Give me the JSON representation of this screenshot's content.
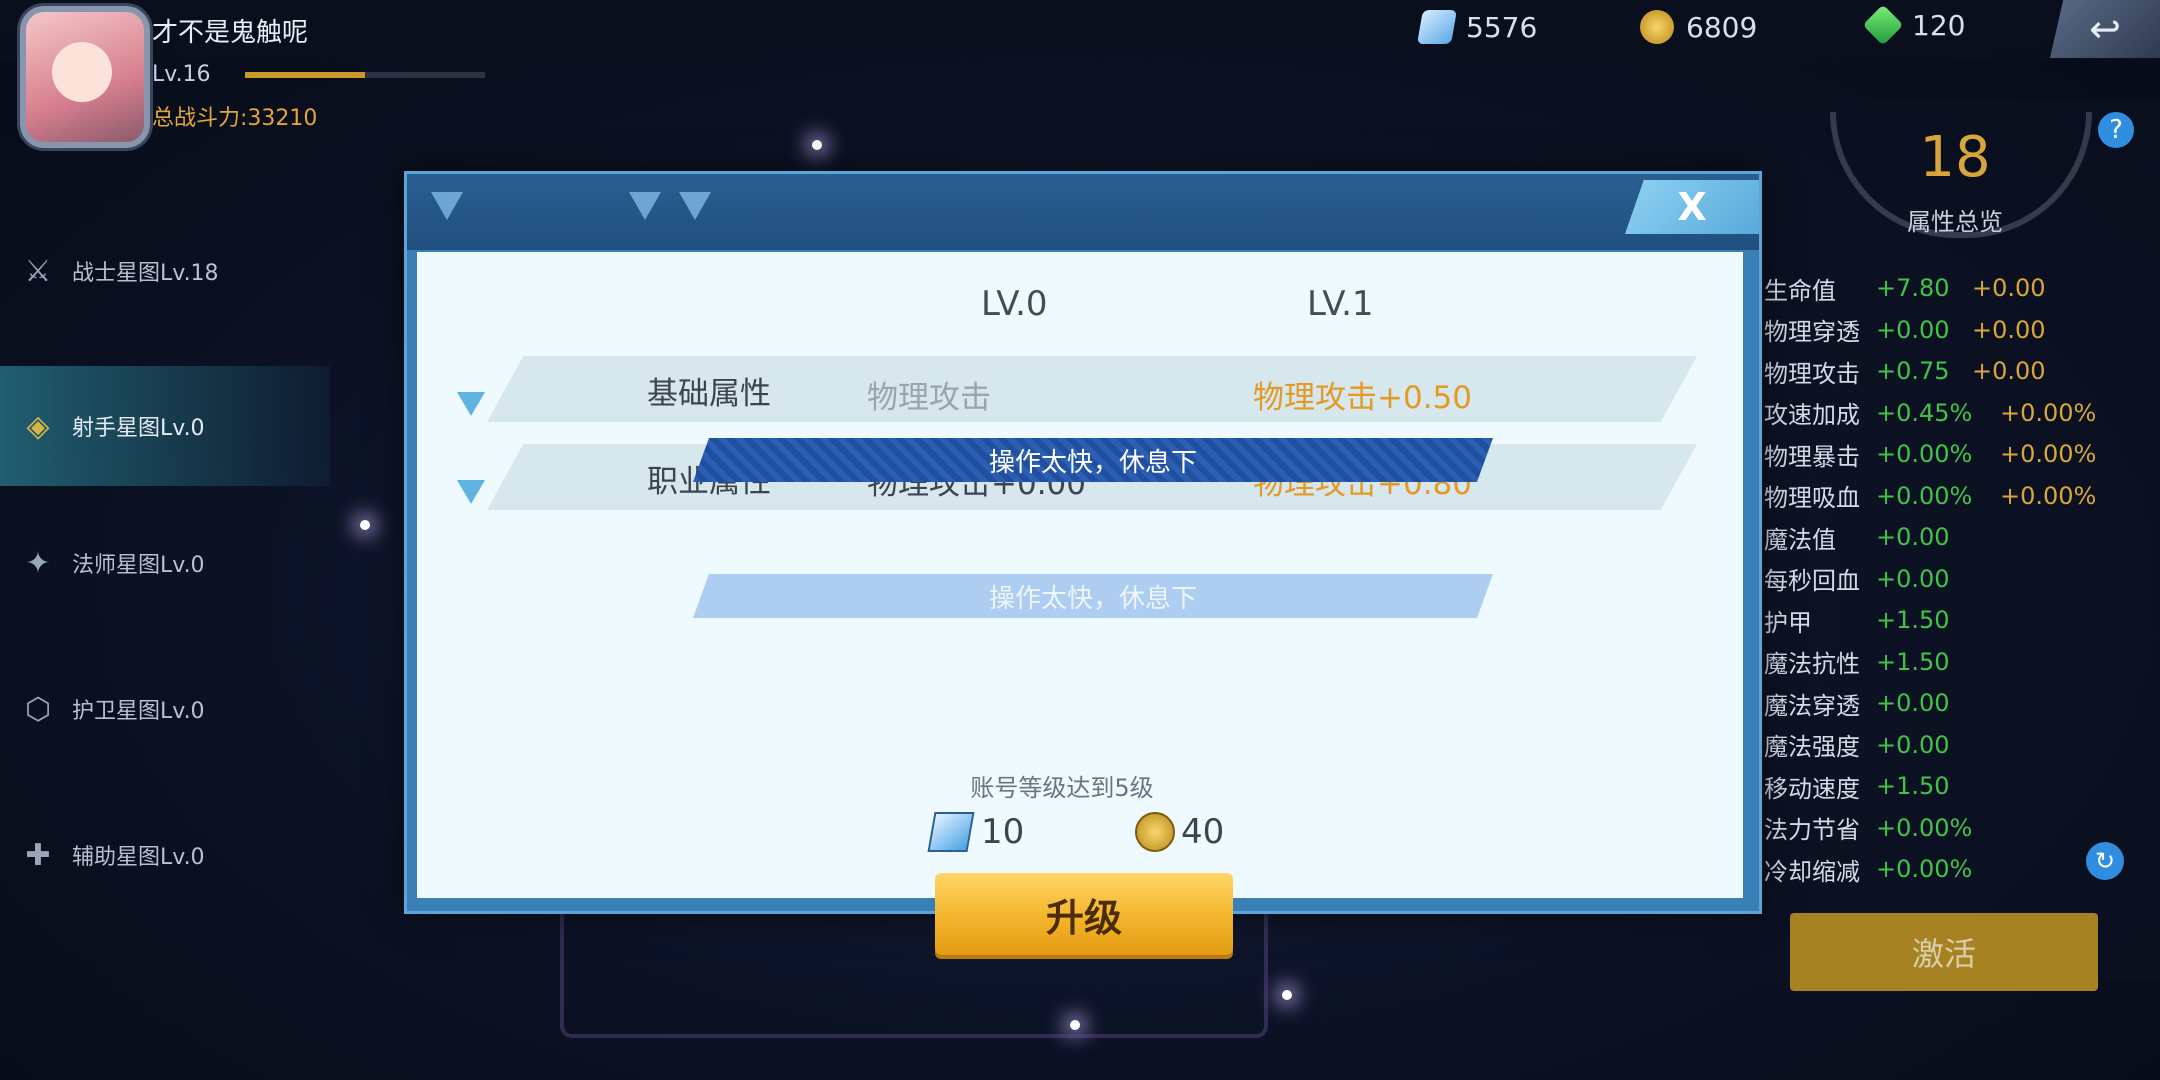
{
  "player": {
    "name": "才不是鬼触呢",
    "level": "Lv.16",
    "xp_progress": 0.5,
    "power": "总战斗力:33210"
  },
  "resources": [
    {
      "icon": "star-crystal-icon",
      "value": "5576"
    },
    {
      "icon": "gold-coin-icon",
      "value": "6809"
    },
    {
      "icon": "green-gem-plus-icon",
      "value": "120"
    }
  ],
  "back_icon": "back-arrow-icon",
  "sidebar": {
    "items": [
      {
        "label": "战士星图Lv.18",
        "icon": "warrior-emblem-icon",
        "active": false
      },
      {
        "label": "射手星图Lv.0",
        "icon": "archer-emblem-icon",
        "active": true
      },
      {
        "label": "法师星图Lv.0",
        "icon": "mage-emblem-icon",
        "active": false
      },
      {
        "label": "护卫星图Lv.0",
        "icon": "guardian-emblem-icon",
        "active": false
      },
      {
        "label": "辅助星图Lv.0",
        "icon": "support-emblem-icon",
        "active": false
      }
    ]
  },
  "right_panel": {
    "level": "18",
    "title": "属性总览",
    "help_icon": "help-icon",
    "stats": [
      {
        "name": "生命值",
        "a": "+7.80",
        "b": "+0.00"
      },
      {
        "name": "物理穿透",
        "a": "+0.00",
        "b": "+0.00"
      },
      {
        "name": "物理攻击",
        "a": "+0.75",
        "b": "+0.00"
      },
      {
        "name": "攻速加成",
        "a": "+0.45%",
        "b": "+0.00%"
      },
      {
        "name": "物理暴击",
        "a": "+0.00%",
        "b": "+0.00%"
      },
      {
        "name": "物理吸血",
        "a": "+0.00%",
        "b": "+0.00%"
      },
      {
        "name": "魔法值",
        "a": "+0.00",
        "b": ""
      },
      {
        "name": "每秒回血",
        "a": "+0.00",
        "b": ""
      },
      {
        "name": "护甲",
        "a": "+1.50",
        "b": ""
      },
      {
        "name": "魔法抗性",
        "a": "+1.50",
        "b": ""
      },
      {
        "name": "魔法穿透",
        "a": "+0.00",
        "b": ""
      },
      {
        "name": "魔法强度",
        "a": "+0.00",
        "b": ""
      },
      {
        "name": "移动速度",
        "a": "+1.50",
        "b": ""
      },
      {
        "name": "法力节省",
        "a": "+0.00%",
        "b": ""
      },
      {
        "name": "冷却缩减",
        "a": "+0.00%",
        "b": ""
      }
    ],
    "activate_label": "激活"
  },
  "dialog": {
    "close_label": "X",
    "current_level": "LV.0",
    "next_level": "LV.1",
    "rows": [
      {
        "label": "基础属性",
        "current": "物理攻击",
        "next": "物理攻击+0.50"
      },
      {
        "label": "职业属性",
        "current": "物理攻击+0.00",
        "next": "物理攻击+0.80"
      }
    ],
    "toast": "操作太快，休息下",
    "requirement": "账号等级达到5级",
    "cost": [
      {
        "icon": "star-crystal-icon",
        "value": "10"
      },
      {
        "icon": "gold-coin-icon",
        "value": "40"
      }
    ],
    "upgrade_label": "升级"
  }
}
